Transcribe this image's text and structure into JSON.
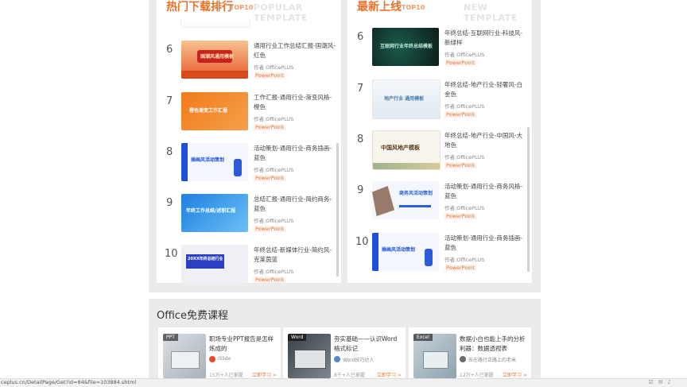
{
  "hot": {
    "title": "热门下载排行",
    "tag": "TOP10",
    "watermark": "POPULAR TEMPLATE",
    "items": [
      {
        "rank": "6",
        "title": "通用行业工作总结汇报-国潮风-红色",
        "author": "作者:OfficePLUS",
        "type": "PowerPoint",
        "thumb_text": "国潮风通用模板"
      },
      {
        "rank": "7",
        "title": "工作汇报-通用行业-渐变风格-橙色",
        "author": "作者:OfficePLUS",
        "type": "PowerPoint",
        "thumb_text": "橙色渐变工作汇报"
      },
      {
        "rank": "8",
        "title": "活动策划-通用行业-商务插画-蓝色",
        "author": "作者:OfficePLUS",
        "type": "PowerPoint",
        "thumb_text": "插画风活动策划"
      },
      {
        "rank": "9",
        "title": "总结汇报-通用行业-简约商务-蓝色",
        "author": "作者:OfficePLUS",
        "type": "PowerPoint",
        "thumb_text": "年终工作总结/述职汇报"
      },
      {
        "rank": "10",
        "title": "年终总结-新媒体行业-简约风-克莱茵蓝",
        "author": "作者:OfficePLUS",
        "type": "PowerPoint",
        "thumb_text": "20XX年终总结行业通用模板"
      }
    ]
  },
  "new": {
    "title": "最新上线",
    "tag": "TOP10",
    "watermark": "NEW TEMPLATE",
    "items": [
      {
        "rank": "6",
        "title": "年终总结-互联网行业-科技风-新绿样",
        "author": "作者:OfficePLUS",
        "type": "PowerPoint",
        "thumb_text": "互联网行业年终总结模板"
      },
      {
        "rank": "7",
        "title": "年终总结-地产行业-轻奢风-白金色",
        "author": "作者:OfficePLUS",
        "type": "PowerPoint",
        "thumb_text": "地产行业  通用模板"
      },
      {
        "rank": "8",
        "title": "年终总结-地产行业-中国风-大地色",
        "author": "作者:OfficePLUS",
        "type": "PowerPoint",
        "thumb_text": "中国风地产模板"
      },
      {
        "rank": "9",
        "title": "活动策划-通用行业-商务风格-蓝色",
        "author": "作者:OfficePLUS",
        "type": "PowerPoint",
        "thumb_text": "商务风活动策划"
      },
      {
        "rank": "10",
        "title": "活动策划-通用行业-商务插画-蓝色",
        "author": "作者:OfficePLUS",
        "type": "PowerPoint",
        "thumb_text": "插画风活动策划"
      }
    ]
  },
  "courses": {
    "heading": "Office免费课程",
    "items": [
      {
        "badge": "PPT",
        "title": "职场专业PPT报告是怎样炼成的",
        "author": "iSlide",
        "learners": "15万+人已掌握",
        "study": "立即学习 >"
      },
      {
        "badge": "Word",
        "title": "夯实基础——认识Word格式标记",
        "author": "Word技巧达人",
        "learners": "8千+人已掌握",
        "study": "立即学习 >"
      },
      {
        "badge": "Excel",
        "title": "数据小白也能上手的分析利器：数据透视表",
        "author": "去在路行正路上的老米",
        "learners": "12万+人已掌握",
        "study": "立即学习 >"
      }
    ]
  },
  "status": {
    "url": "ceplus.cn/DetailPage/Get?id=84&file=103884.shtml",
    "icons": [
      "check-icon",
      "mail-icon",
      "speaker-icon"
    ]
  },
  "colors": {
    "accent": "#e8722b",
    "panel": "#ebebeb"
  }
}
